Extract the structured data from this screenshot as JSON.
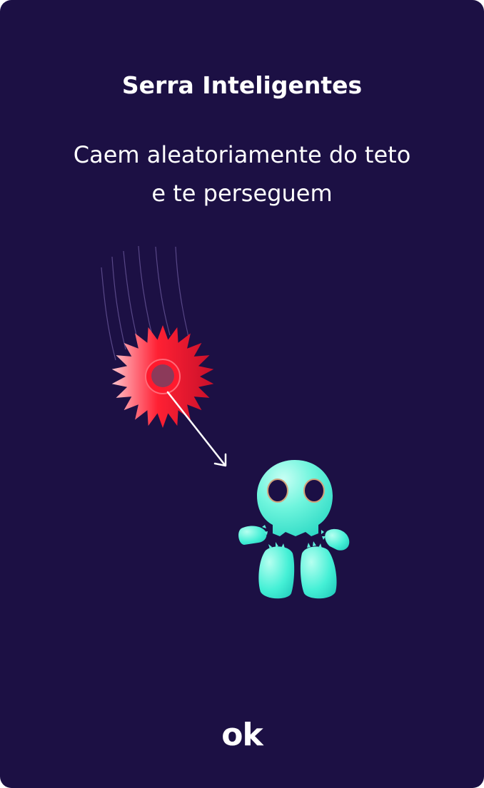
{
  "card": {
    "title": "Serra Inteligentes",
    "description": "Caem aleatoriamente do teto e te perseguem",
    "ok_label": "ok"
  },
  "illustration": {
    "saw_icon": "spinning-saw-blade",
    "enemy_icon": "ghost-skull-creature",
    "arrow_icon": "chase-direction-arrow"
  },
  "colors": {
    "background": "#1c1044",
    "saw": "#ff1a2e",
    "creature": "#3ff0d6",
    "text": "#ffffff"
  }
}
